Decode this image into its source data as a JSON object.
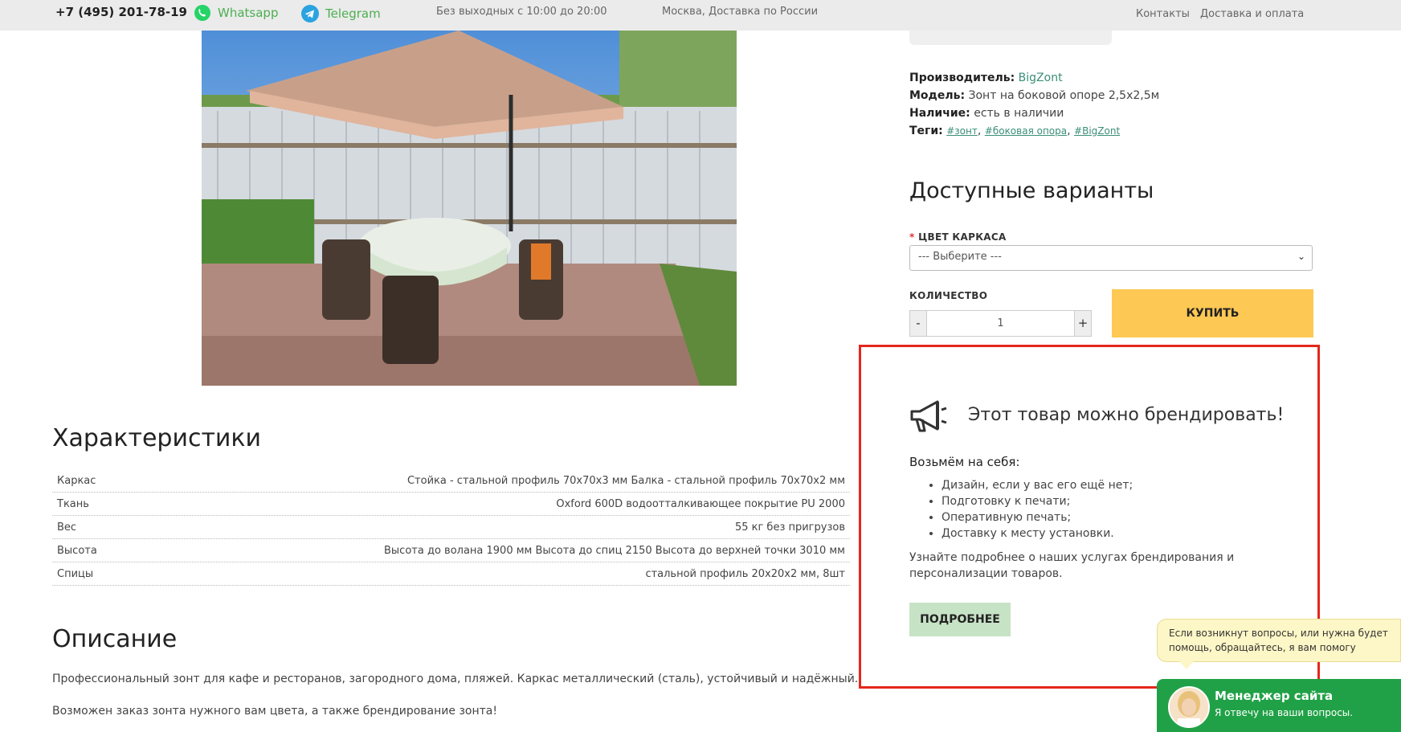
{
  "topbar": {
    "phone": "+7 (495) 201-78-19",
    "whatsapp": "Whatsapp",
    "telegram": "Telegram",
    "hours": "Без выходных с 10:00 до 20:00",
    "city": "Москва, Доставка по России",
    "links": [
      "Контакты",
      "Доставка и оплата"
    ]
  },
  "product": {
    "manufacturer_label": "Производитель:",
    "manufacturer": "BigZont",
    "model_label": "Модель:",
    "model": "Зонт на боковой опоре 2,5х2,5м",
    "availability_label": "Наличие:",
    "availability": "есть в наличии",
    "tags_label": "Теги:",
    "tags": [
      "#зонт",
      "#боковая опора",
      "#BigZont"
    ]
  },
  "options": {
    "title": "Доступные варианты",
    "required_mark": "*",
    "frame_color_label": "ЦВЕТ КАРКАСА",
    "frame_color_selected": "--- Выберите ---",
    "quantity_label": "КОЛИЧЕСТВО",
    "quantity_minus": "-",
    "quantity_value": "1",
    "quantity_plus": "+",
    "buy_label": "КУПИТЬ"
  },
  "branding": {
    "title": "Этот товар можно брендировать!",
    "take_label": "Возьмём на себя:",
    "items": [
      "Дизайн, если у вас его ещё нет;",
      "Подготовку к печати;",
      "Оперативную печать;",
      "Доставку к месту установки."
    ],
    "text": "Узнайте подробнее о наших услугах брендирования и персонализации товаров.",
    "more_label": "ПОДРОБНЕЕ"
  },
  "specs": {
    "title": "Характеристики",
    "rows": [
      {
        "name": "Каркас",
        "value": "Стойка - стальной профиль 70х70х3 мм Балка - стальной профиль 70х70х2 мм"
      },
      {
        "name": "Ткань",
        "value": "Oxford 600D водоотталкивающее покрытие PU 2000"
      },
      {
        "name": "Вес",
        "value": "55 кг без пригрузов"
      },
      {
        "name": "Высота",
        "value": "Высота до волана 1900 мм Высота до спиц 2150 Высота до верхней точки 3010 мм"
      },
      {
        "name": "Спицы",
        "value": "стальной профиль 20х20х2 мм, 8шт"
      }
    ]
  },
  "description": {
    "title": "Описание",
    "p1": "Профессиональный зонт для кафе и ресторанов, загородного дома, пляжей. Каркас металлический (сталь), устойчивый и надёжный.",
    "p2": "Возможен заказ зонта нужного вам цвета, а также брендирование зонта!"
  },
  "chat": {
    "bubble": "Если возникнут вопросы, или нужна будет помощь, обращайтесь, я вам помогу",
    "name": "Менеджер сайта",
    "subtitle": "Я отвечу на ваши вопросы."
  },
  "colors": {
    "accent_green": "#3a8f77",
    "buy_yellow": "#fdc853",
    "more_green": "#c7e3c6",
    "chat_green": "#21a147",
    "highlight_red": "#e3271c"
  }
}
